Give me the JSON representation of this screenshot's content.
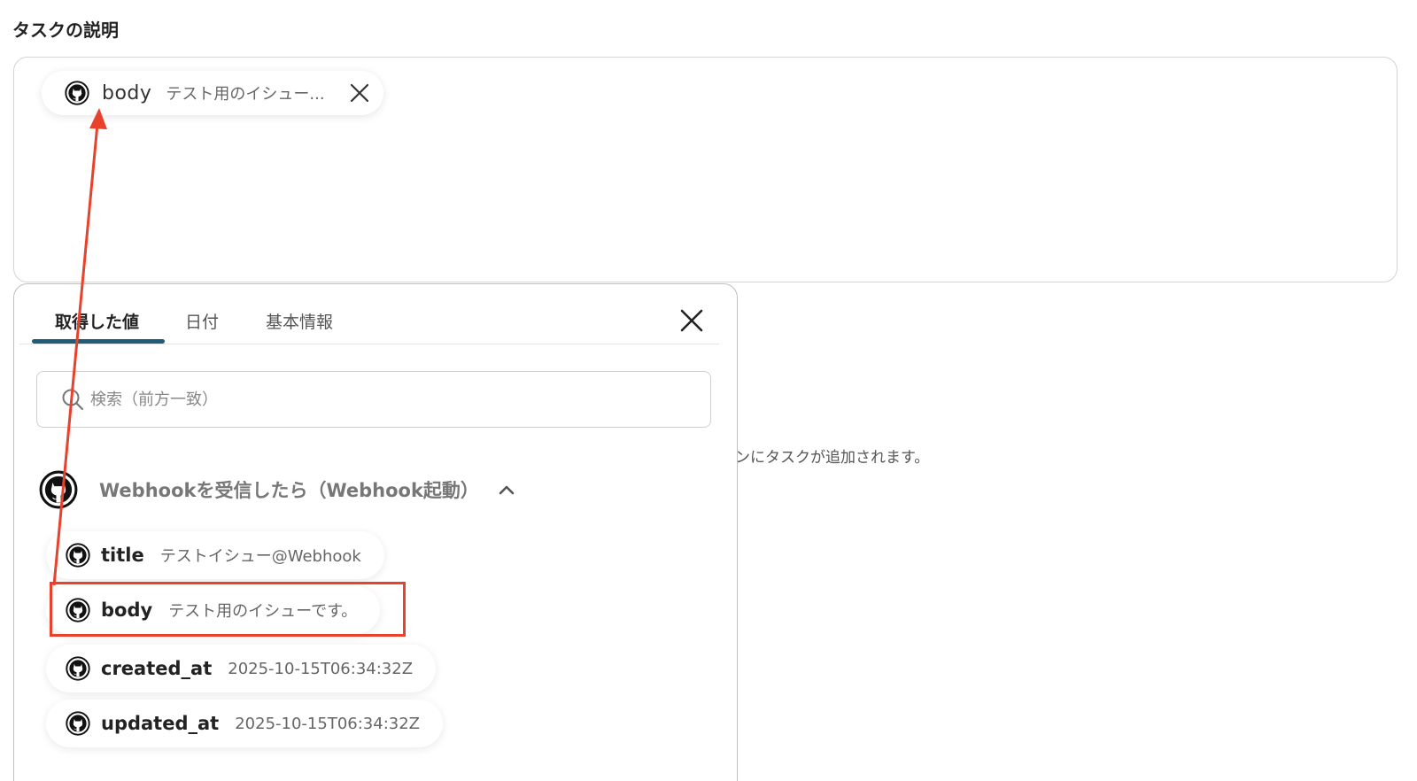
{
  "section": {
    "title": "タスクの説明"
  },
  "description_field": {
    "chip": {
      "key": "body",
      "value": "テスト用のイシュー..."
    }
  },
  "hint": {
    "text": "ンにタスクが追加されます。"
  },
  "popup": {
    "tabs": [
      {
        "label": "取得した値",
        "active": true
      },
      {
        "label": "日付",
        "active": false
      },
      {
        "label": "基本情報",
        "active": false
      }
    ],
    "search": {
      "placeholder": "検索（前方一致）",
      "value": ""
    },
    "group": {
      "label": "Webhookを受信したら（Webhook起動）",
      "expanded": true
    },
    "items": [
      {
        "key": "title",
        "value": "テストイシュー@Webhook"
      },
      {
        "key": "body",
        "value": "テスト用のイシューです。"
      },
      {
        "key": "created_at",
        "value": "2025-10-15T06:34:32Z"
      },
      {
        "key": "updated_at",
        "value": "2025-10-15T06:34:32Z"
      }
    ]
  },
  "colors": {
    "annotation": "#e8412c",
    "tab_underline": "#1f5c78"
  },
  "icons": {
    "source": "github-icon",
    "remove": "close-icon",
    "popup_close": "close-icon",
    "search": "search-icon",
    "collapse": "chevron-up-icon"
  }
}
